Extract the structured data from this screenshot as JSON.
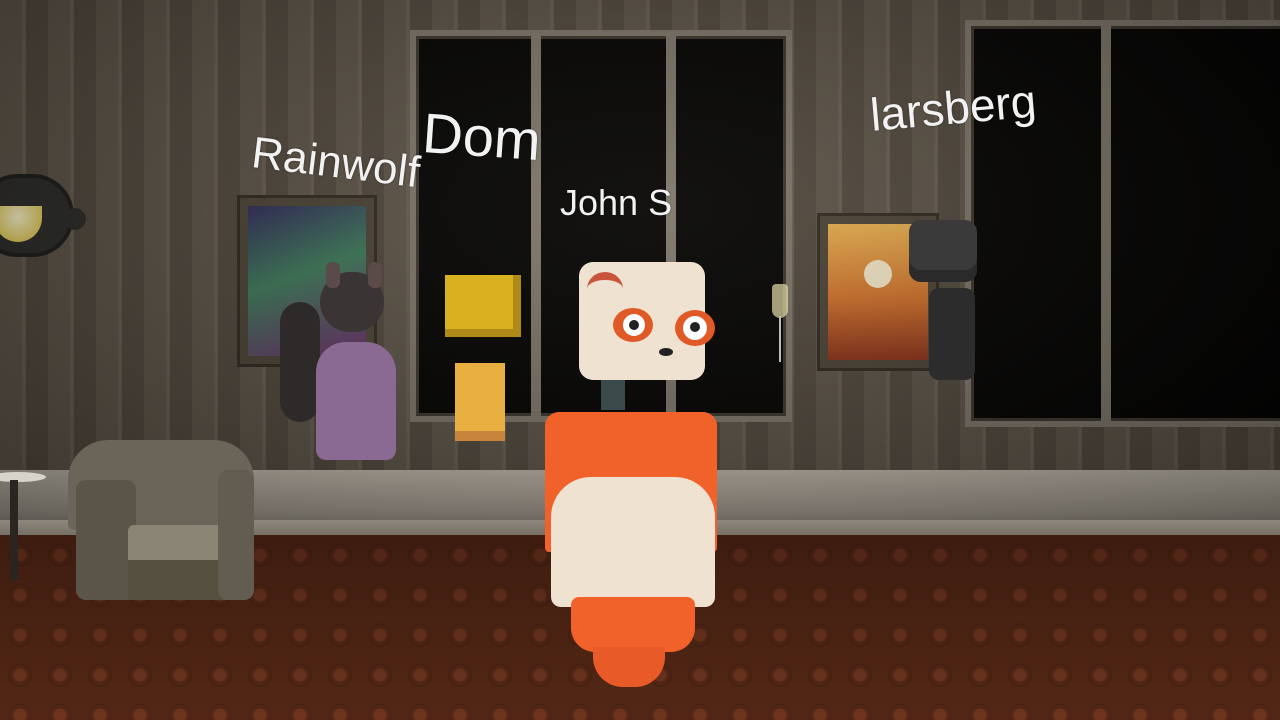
{
  "players": [
    {
      "name": "Rainwolf"
    },
    {
      "name": "Dom"
    },
    {
      "name": "John S"
    },
    {
      "name": "larsberg"
    }
  ],
  "colors": {
    "avatar_orange": "#f0622a",
    "avatar_cream": "#efe2d0",
    "nametag_text": "#f2f2f2",
    "carpet": "#5e2c18",
    "wall": "#5b5348"
  }
}
